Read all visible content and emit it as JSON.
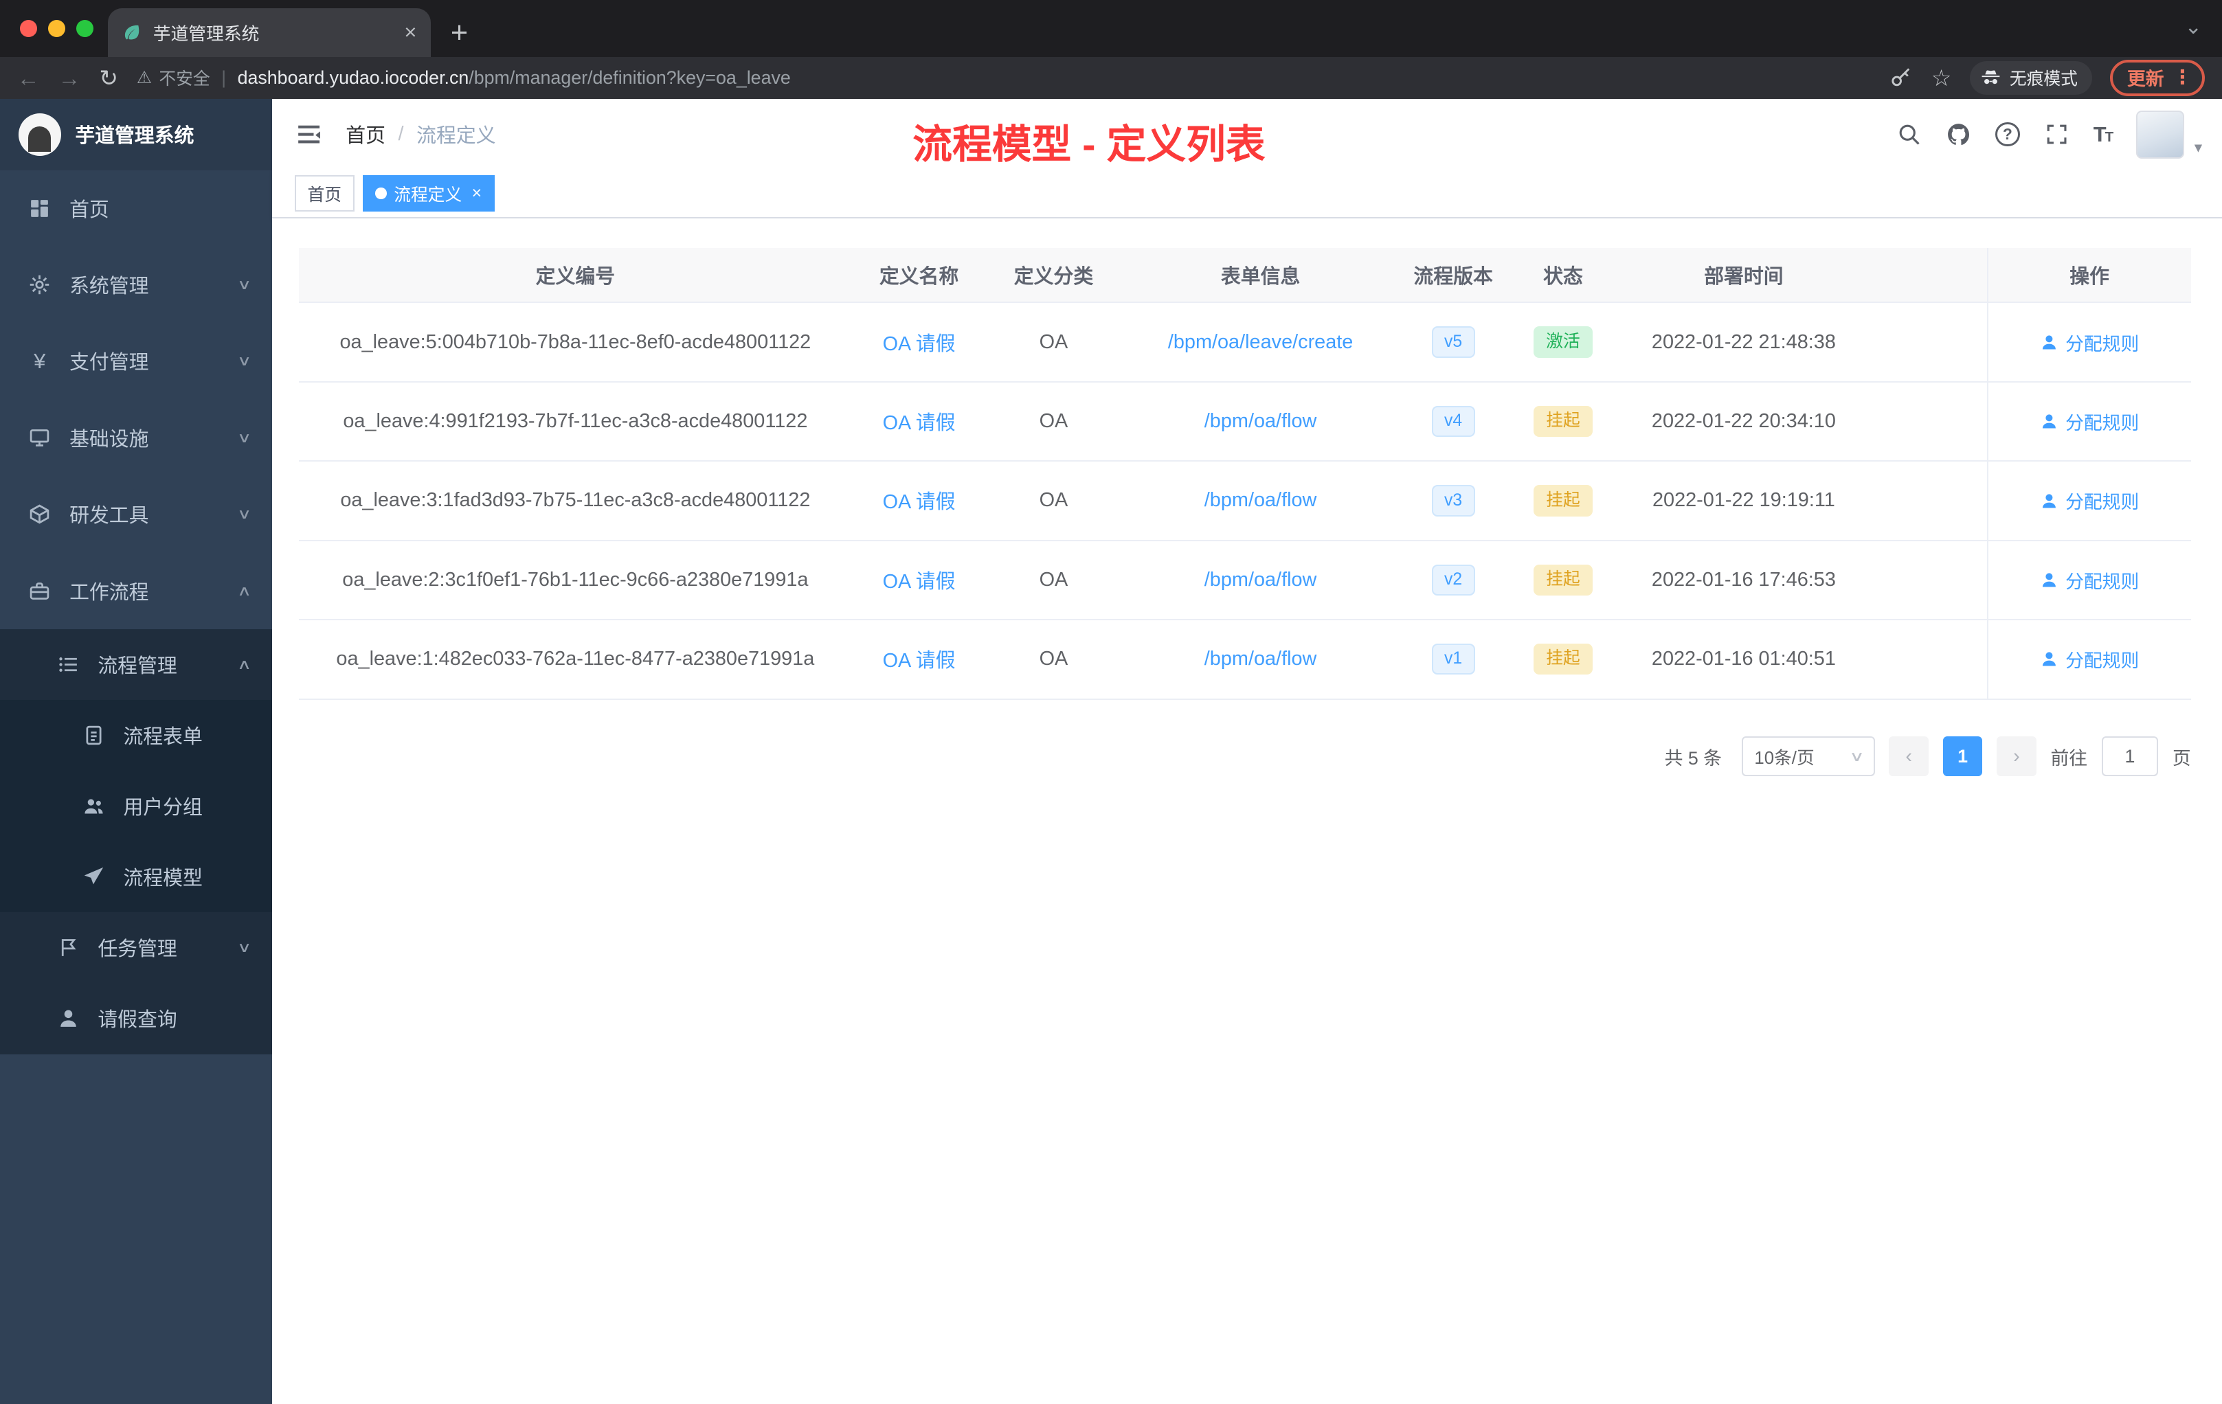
{
  "browser": {
    "tab_title": "芋道管理系统",
    "security_label": "不安全",
    "url_host": "dashboard.yudao.iocoder.cn",
    "url_path": "/bpm/manager/definition?key=oa_leave",
    "incognito_label": "无痕模式",
    "update_label": "更新"
  },
  "sidebar": {
    "brand": "芋道管理系统",
    "menu": [
      {
        "label": "首页"
      },
      {
        "label": "系统管理"
      },
      {
        "label": "支付管理"
      },
      {
        "label": "基础设施"
      },
      {
        "label": "研发工具"
      },
      {
        "label": "工作流程"
      }
    ],
    "submenu": [
      {
        "label": "流程管理"
      },
      {
        "label": "流程表单"
      },
      {
        "label": "用户分组"
      },
      {
        "label": "流程模型"
      },
      {
        "label": "任务管理"
      },
      {
        "label": "请假查询"
      }
    ]
  },
  "navbar": {
    "breadcrumb_home": "首页",
    "breadcrumb_current": "流程定义",
    "annotation": "流程模型 - 定义列表"
  },
  "tags": {
    "home": "首页",
    "current": "流程定义"
  },
  "table": {
    "headers": [
      "定义编号",
      "定义名称",
      "定义分类",
      "表单信息",
      "流程版本",
      "状态",
      "部署时间",
      "操作"
    ],
    "action_label": "分配规则",
    "rows": [
      {
        "id": "oa_leave:5:004b710b-7b8a-11ec-8ef0-acde48001122",
        "name": "OA 请假",
        "category": "OA",
        "form": "/bpm/oa/leave/create",
        "version": "v5",
        "status": "激活",
        "status_type": "active",
        "time": "2022-01-22 21:48:38"
      },
      {
        "id": "oa_leave:4:991f2193-7b7f-11ec-a3c8-acde48001122",
        "name": "OA 请假",
        "category": "OA",
        "form": "/bpm/oa/flow",
        "version": "v4",
        "status": "挂起",
        "status_type": "suspend",
        "time": "2022-01-22 20:34:10"
      },
      {
        "id": "oa_leave:3:1fad3d93-7b75-11ec-a3c8-acde48001122",
        "name": "OA 请假",
        "category": "OA",
        "form": "/bpm/oa/flow",
        "version": "v3",
        "status": "挂起",
        "status_type": "suspend",
        "time": "2022-01-22 19:19:11"
      },
      {
        "id": "oa_leave:2:3c1f0ef1-76b1-11ec-9c66-a2380e71991a",
        "name": "OA 请假",
        "category": "OA",
        "form": "/bpm/oa/flow",
        "version": "v2",
        "status": "挂起",
        "status_type": "suspend",
        "time": "2022-01-16 17:46:53"
      },
      {
        "id": "oa_leave:1:482ec033-762a-11ec-8477-a2380e71991a",
        "name": "OA 请假",
        "category": "OA",
        "form": "/bpm/oa/flow",
        "version": "v1",
        "status": "挂起",
        "status_type": "suspend",
        "time": "2022-01-16 01:40:51"
      }
    ]
  },
  "pagination": {
    "total": "共 5 条",
    "page_size": "10条/页",
    "prev": "‹",
    "current_page": "1",
    "next": "›",
    "goto_label": "前往",
    "goto_value": "1",
    "unit_label": "页"
  }
}
